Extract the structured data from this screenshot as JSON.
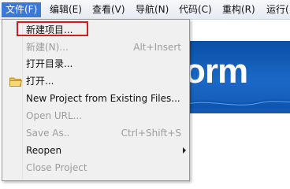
{
  "menubar": {
    "items": [
      {
        "label": "文件(F)"
      },
      {
        "label": "编辑(E)"
      },
      {
        "label": "查看(V)"
      },
      {
        "label": "导航(N)"
      },
      {
        "label": "代码(C)"
      },
      {
        "label": "重构(R)"
      },
      {
        "label": "运行("
      }
    ]
  },
  "background": {
    "logo_text": "orm"
  },
  "file_menu": {
    "items": [
      {
        "label": "新建项目...",
        "shortcut": "",
        "disabled": false,
        "icon": "",
        "highlighted_box": true
      },
      {
        "label": "新建(N)...",
        "shortcut": "Alt+Insert",
        "disabled": true,
        "icon": ""
      },
      {
        "label": "打开目录...",
        "shortcut": "",
        "disabled": false,
        "icon": ""
      },
      {
        "label": "打开...",
        "shortcut": "",
        "disabled": false,
        "icon": "folder-icon"
      },
      {
        "label": "New Project from Existing Files...",
        "shortcut": "",
        "disabled": false,
        "icon": ""
      },
      {
        "label": "Open URL...",
        "shortcut": "",
        "disabled": true,
        "icon": ""
      },
      {
        "label": "Save As..",
        "shortcut": "Ctrl+Shift+S",
        "disabled": true,
        "icon": ""
      },
      {
        "label": "Reopen",
        "shortcut": "",
        "disabled": false,
        "icon": "",
        "submenu": true
      },
      {
        "label": "Close Project",
        "shortcut": "",
        "disabled": true,
        "icon": ""
      }
    ]
  },
  "colors": {
    "highlight_border": "#d61b1b",
    "active_menu": "#3c78d8",
    "banner_blue": "#1a69c6",
    "disabled_text": "#9d9d9d"
  }
}
